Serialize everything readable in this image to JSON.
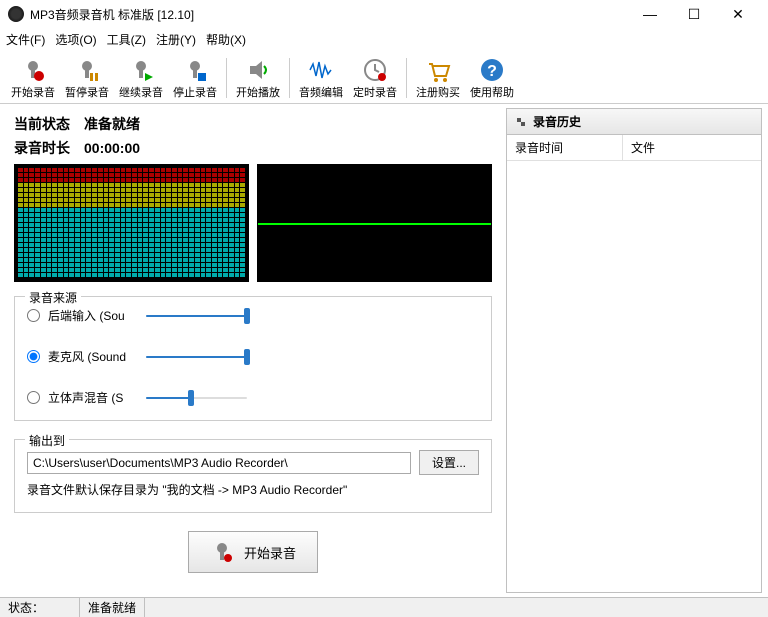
{
  "title": "MP3音频录音机 标准版 [12.10]",
  "menu": {
    "file": "文件(F)",
    "options": "选项(O)",
    "tools": "工具(Z)",
    "register": "注册(Y)",
    "help": "帮助(X)"
  },
  "toolbar": {
    "start_record": "开始录音",
    "pause_record": "暂停录音",
    "resume_record": "继续录音",
    "stop_record": "停止录音",
    "play": "开始播放",
    "audio_edit": "音频编辑",
    "timed_record": "定时录音",
    "register_buy": "注册购买",
    "help": "使用帮助"
  },
  "status": {
    "label": "当前状态",
    "value": "准备就绪",
    "time_label": "录音时长",
    "time_value": "00:00:00"
  },
  "source": {
    "group": "录音来源",
    "line_in": "后端输入 (Sou",
    "stereo_mix": "立体声混音 (S",
    "microphone": "麦克风 (Sound",
    "selected": "microphone",
    "line_in_vol": 100,
    "stereo_mix_vol": 45,
    "microphone_vol": 100
  },
  "output": {
    "group": "输出到",
    "path": "C:\\Users\\user\\Documents\\MP3 Audio Recorder\\",
    "settings_btn": "设置...",
    "note": "录音文件默认保存目录为 \"我的文档 -> MP3 Audio Recorder\""
  },
  "big_button": "开始录音",
  "history": {
    "title": "录音历史",
    "col_time": "录音时间",
    "col_file": "文件"
  },
  "statusbar": {
    "label": "状态：",
    "value": "准备就绪"
  }
}
